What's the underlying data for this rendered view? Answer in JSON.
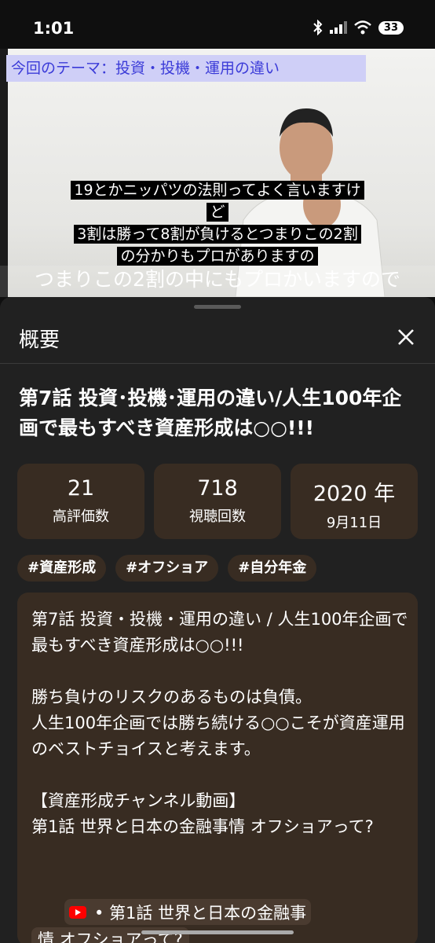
{
  "status": {
    "time": "1:01",
    "battery": "33"
  },
  "video": {
    "theme_banner": "今回のテーマ：投資・投機・運用の違い",
    "subtitle_lines": [
      "19とかニッパツの法則ってよく言いますけ",
      "ど",
      "3割は勝って8割が負けるとつまりこの2割",
      "の分かりもプロがありますの"
    ],
    "bottom_caption": "つまりこの2割の中にもプロかいますので"
  },
  "sheet": {
    "title": "概要",
    "video_title": "第7話 投資･投機･運用の違い/人生100年企画で最もすべき資産形成は○○!!!",
    "stats": [
      {
        "value": "21",
        "label": "高評価数"
      },
      {
        "value": "718",
        "label": "視聴回数"
      },
      {
        "value": "2020 年",
        "label": "9月11日"
      }
    ],
    "tags": [
      "#資産形成",
      "#オフショア",
      "#自分年金"
    ],
    "description": {
      "lines": [
        "第7話 投資・投機・運用の違い / 人生100年企画で最もすべき資産形成は○○!!!",
        "",
        "勝ち負けのリスクのあるものは負債。",
        "人生100年企画では勝ち続ける○○こそが資産運用のベストチョイスと考えます。",
        "",
        "【資産形成チャンネル動画】",
        "第1話 世界と日本の金融事情 オフショアって?"
      ],
      "chip_line1": "•  第1話 世界と日本の金融事",
      "chip_line2": "情 オフショアって?"
    }
  }
}
